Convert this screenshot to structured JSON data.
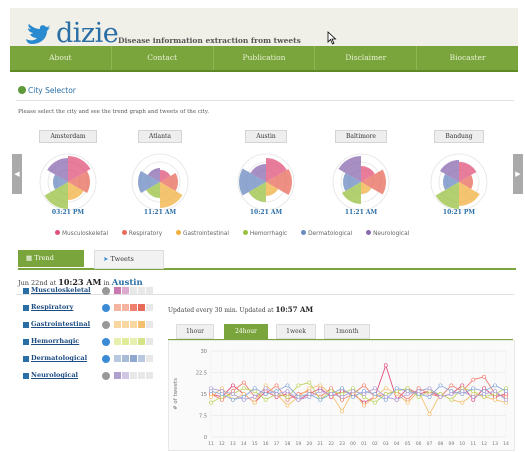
{
  "header": {
    "logo_text": "dizie",
    "tagline": "Disease information extraction from tweets"
  },
  "nav": [
    "About",
    "Contact",
    "Publication",
    "Disclaimer",
    "Biocaster"
  ],
  "city_selector": {
    "title": "City Selector",
    "instructions": "Please select the city and see the trend graph and tweets of the city.",
    "cities": [
      {
        "name": "Amsterdam",
        "time": "03:21 PM"
      },
      {
        "name": "Atlanta",
        "time": "11:21 AM"
      },
      {
        "name": "Austin",
        "time": "10:21 AM"
      },
      {
        "name": "Baltimore",
        "time": "11:21 AM"
      },
      {
        "name": "Bandung",
        "time": "10:21 PM"
      }
    ]
  },
  "legend": [
    {
      "label": "Musculoskeletal",
      "color": "#e0507a"
    },
    {
      "label": "Respiratory",
      "color": "#e86a5a"
    },
    {
      "label": "Gastrointestinal",
      "color": "#f0b040"
    },
    {
      "label": "Hemorrhagic",
      "color": "#9ac040"
    },
    {
      "label": "Dermatological",
      "color": "#6a8ac0"
    },
    {
      "label": "Neurological",
      "color": "#8a6ab0"
    }
  ],
  "tabs": {
    "trend": "Trend Graph",
    "tweets": "Tweets"
  },
  "date_line": {
    "prefix": "Jun 22nd at",
    "time": "10:23 AM",
    "mid": "in",
    "city": "Austin"
  },
  "diseases": [
    {
      "name": "Musculoskeletal",
      "twitter_active": false,
      "colors": [
        "#c97ab0",
        "#ddaad0",
        "#e8e8e8",
        "#e8e8e8",
        "#e8e8e8"
      ]
    },
    {
      "name": "Respiratory",
      "twitter_active": true,
      "colors": [
        "#f4b4a0",
        "#f4b4a0",
        "#f08070",
        "#e86a5a",
        "#e8e8e8"
      ]
    },
    {
      "name": "Gastrointestinal",
      "twitter_active": false,
      "colors": [
        "#f8d8a0",
        "#f8d8a0",
        "#f8d8a0",
        "#f4c070",
        "#e8e8e8"
      ]
    },
    {
      "name": "Hemorrhagic",
      "twitter_active": true,
      "colors": [
        "#e8f0b0",
        "#e0ec98",
        "#e8f0b0",
        "#d4e488",
        "#e8e8e8"
      ]
    },
    {
      "name": "Dermatological",
      "twitter_active": true,
      "colors": [
        "#b8c8e0",
        "#a8bcd8",
        "#90a8d0",
        "#b8c8e0",
        "#e8e8e8"
      ]
    },
    {
      "name": "Neurological",
      "twitter_active": false,
      "colors": [
        "#b0a0d0",
        "#d0c8e4",
        "#e8e8e8",
        "#e8e8e8",
        "#e8e8e8"
      ]
    }
  ],
  "update": {
    "text": "Updated every 30 min. Updated at",
    "time": "10:57 AM"
  },
  "periods": [
    {
      "label": "1hour",
      "active": false
    },
    {
      "label": "24hour",
      "active": true
    },
    {
      "label": "1week",
      "active": false
    },
    {
      "label": "1month",
      "active": false
    }
  ],
  "chart_data": {
    "type": "line",
    "ylabel": "# of tweets",
    "ylim": [
      0,
      30
    ],
    "yticks": [
      0,
      7.5,
      15,
      22.5,
      30
    ],
    "x": [
      "11",
      "12",
      "13",
      "14",
      "15",
      "16",
      "17",
      "18",
      "19",
      "20",
      "21",
      "22",
      "23",
      "00",
      "01",
      "02",
      "03",
      "04",
      "05",
      "06",
      "07",
      "08",
      "09",
      "10",
      "11",
      "12",
      "13",
      "14"
    ],
    "series": [
      {
        "color": "#e0507a",
        "values": [
          15,
          14,
          18,
          15,
          12,
          16,
          14,
          15,
          13,
          15,
          17,
          14,
          16,
          15,
          12,
          14,
          25,
          13,
          17,
          15,
          16,
          14,
          15,
          18,
          13,
          17,
          14,
          15
        ]
      },
      {
        "color": "#f08070",
        "values": [
          15,
          13,
          16,
          19,
          14,
          15,
          18,
          13,
          15,
          16,
          14,
          17,
          13,
          15,
          18,
          14,
          15,
          16,
          13,
          17,
          15,
          14,
          18,
          16,
          20,
          21,
          15,
          14
        ]
      },
      {
        "color": "#f4c070",
        "values": [
          14,
          17,
          13,
          15,
          12,
          18,
          15,
          11,
          14,
          17,
          18,
          15,
          9,
          16,
          11,
          14,
          17,
          15,
          12,
          16,
          8,
          15,
          13,
          12,
          15,
          14,
          13,
          12
        ]
      },
      {
        "color": "#bcd460",
        "values": [
          12,
          14,
          15,
          17,
          16,
          13,
          15,
          14,
          18,
          19,
          13,
          16,
          15,
          17,
          14,
          12,
          15,
          16,
          17,
          14,
          16,
          15,
          13,
          17,
          16,
          14,
          15,
          17
        ]
      },
      {
        "color": "#8aa8d8",
        "values": [
          16,
          15,
          13,
          14,
          17,
          15,
          16,
          18,
          14,
          15,
          13,
          15,
          17,
          14,
          16,
          15,
          13,
          17,
          16,
          15,
          14,
          18,
          16,
          15,
          17,
          16,
          18,
          16
        ]
      },
      {
        "color": "#b0a0d8",
        "values": [
          17,
          16,
          15,
          13,
          14,
          17,
          15,
          16,
          13,
          14,
          16,
          15,
          14,
          16,
          15,
          17,
          14,
          13,
          15,
          16,
          17,
          14,
          15,
          16,
          14,
          15,
          16,
          13
        ]
      }
    ]
  }
}
